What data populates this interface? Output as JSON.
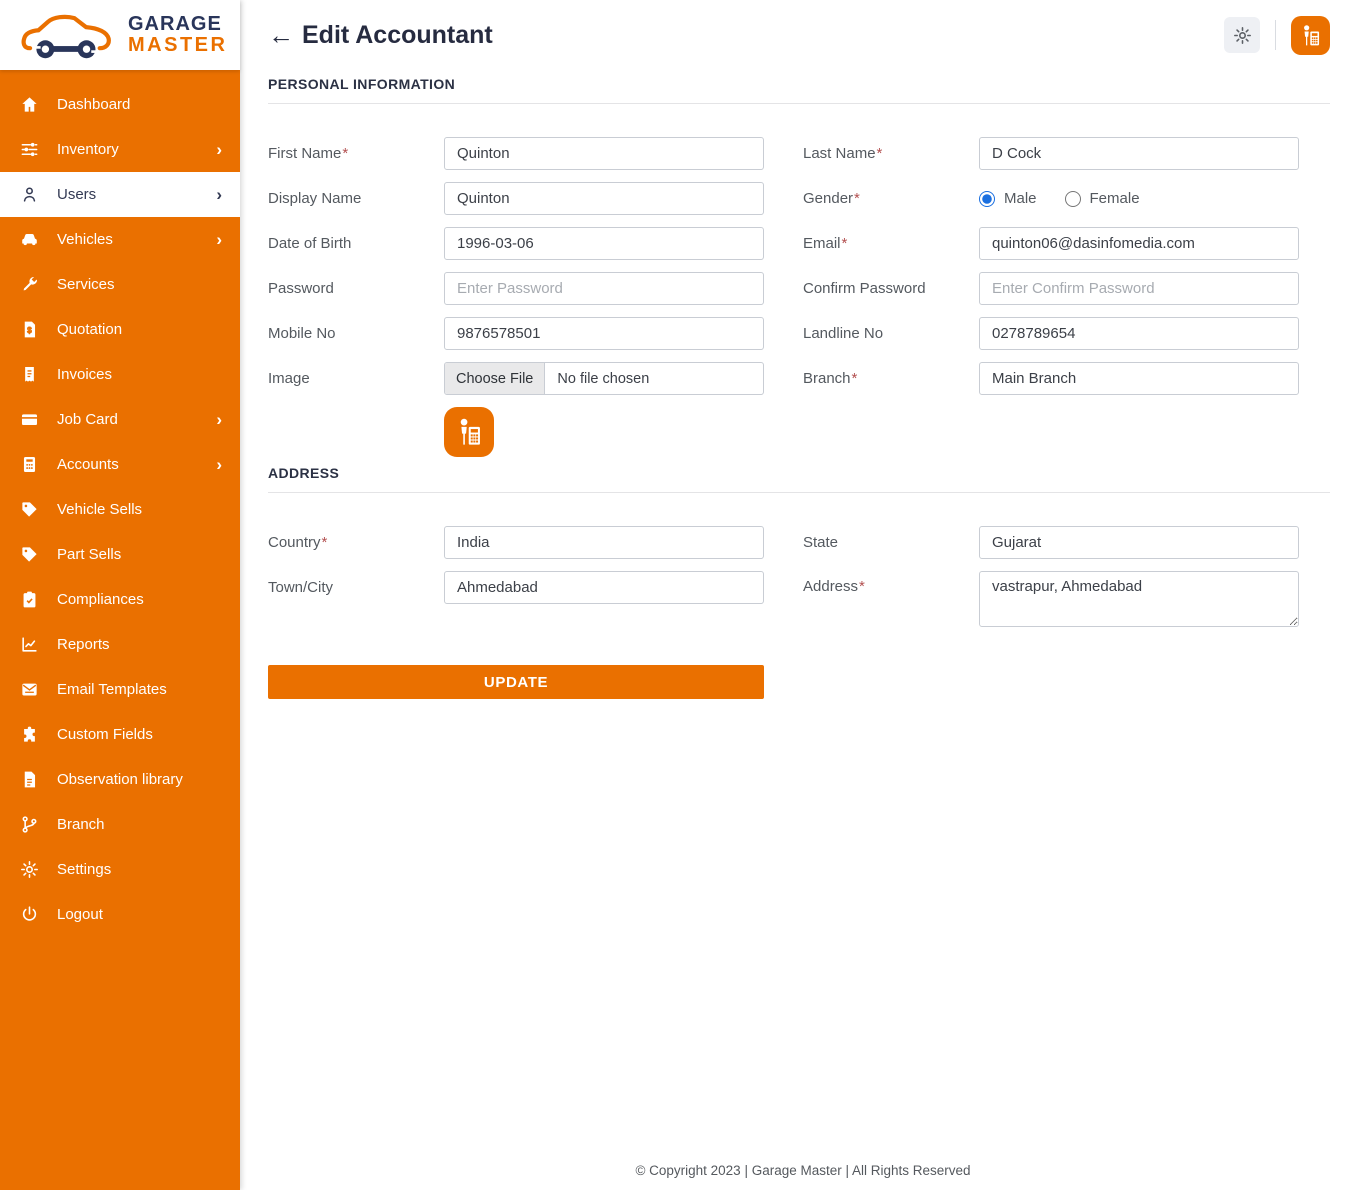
{
  "colors": {
    "accent_orange": "#EA7000",
    "brand_navy": "#29355a",
    "radio_blue": "#1a6fe0"
  },
  "brand": {
    "line1": "GARAGE",
    "line2": "MASTER"
  },
  "sidebar": {
    "items": [
      {
        "label": "Dashboard"
      },
      {
        "label": "Inventory",
        "chevron": "›"
      },
      {
        "label": "Users",
        "chevron": "›",
        "active": true
      },
      {
        "label": "Vehicles",
        "chevron": "›"
      },
      {
        "label": "Services"
      },
      {
        "label": "Quotation"
      },
      {
        "label": "Invoices"
      },
      {
        "label": "Job Card",
        "chevron": "›"
      },
      {
        "label": "Accounts",
        "chevron": "›"
      },
      {
        "label": "Vehicle Sells"
      },
      {
        "label": "Part Sells"
      },
      {
        "label": "Compliances"
      },
      {
        "label": "Reports"
      },
      {
        "label": "Email Templates"
      },
      {
        "label": "Custom Fields"
      },
      {
        "label": "Observation library"
      },
      {
        "label": "Branch"
      },
      {
        "label": "Settings"
      },
      {
        "label": "Logout"
      }
    ]
  },
  "header": {
    "back": "←",
    "title": "Edit Accountant"
  },
  "personal": {
    "title": "PERSONAL INFORMATION",
    "first_name": {
      "label": "First Name",
      "req": "*",
      "value": "Quinton"
    },
    "last_name": {
      "label": "Last Name",
      "req": "*",
      "value": "D Cock"
    },
    "display_name": {
      "label": "Display Name",
      "value": "Quinton"
    },
    "gender": {
      "label": "Gender",
      "req": "*",
      "male": "Male",
      "female": "Female",
      "male_checked": "checked"
    },
    "dob": {
      "label": "Date of Birth",
      "value": "1996-03-06"
    },
    "email": {
      "label": "Email",
      "req": "*",
      "value": "quinton06@dasinfomedia.com"
    },
    "password": {
      "label": "Password",
      "placeholder": "Enter Password"
    },
    "confirm_password": {
      "label": "Confirm Password",
      "placeholder": "Enter Confirm Password"
    },
    "mobile": {
      "label": "Mobile No",
      "value": "9876578501"
    },
    "landline": {
      "label": "Landline No",
      "value": "0278789654"
    },
    "image": {
      "label": "Image",
      "button": "Choose File",
      "status": "No file chosen"
    },
    "branch": {
      "label": "Branch",
      "req": "*",
      "value": "Main Branch"
    }
  },
  "address": {
    "title": "ADDRESS",
    "country": {
      "label": "Country",
      "req": "*",
      "value": "India"
    },
    "state": {
      "label": "State",
      "value": "Gujarat"
    },
    "town": {
      "label": "Town/City",
      "value": "Ahmedabad"
    },
    "addr": {
      "label": "Address",
      "req": "*",
      "value": "vastrapur, Ahmedabad"
    }
  },
  "actions": {
    "update": "UPDATE"
  },
  "footer": {
    "copyright": "© Copyright 2023 | Garage Master | All Rights Reserved"
  }
}
